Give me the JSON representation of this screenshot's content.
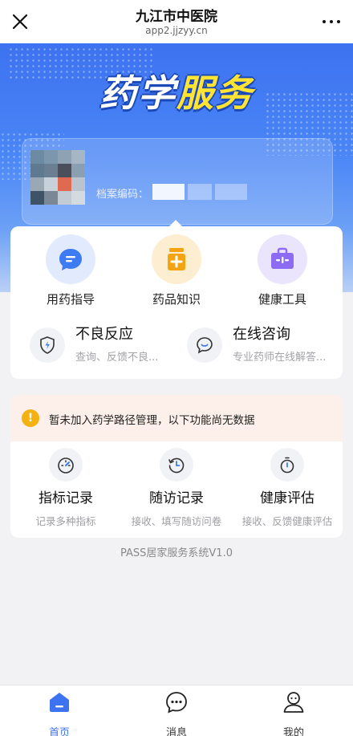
{
  "header": {
    "title": "九江市中医院",
    "url": "app2.jjzyy.cn"
  },
  "hero": {
    "title_white": "药学",
    "title_yellow": "服务"
  },
  "profile": {
    "record_label": "档案编码："
  },
  "services": [
    {
      "label": "用药指导",
      "icon": "chat-bubble-icon",
      "color": "#3d7bf3"
    },
    {
      "label": "药品知识",
      "icon": "medicine-bottle-icon",
      "color": "#f4a412"
    },
    {
      "label": "健康工具",
      "icon": "toolbox-icon",
      "color": "#8b6cf2"
    }
  ],
  "features": [
    {
      "title": "不良反应",
      "desc": "查询、反馈不良...",
      "icon": "shield-bolt-icon"
    },
    {
      "title": "在线咨询",
      "desc": "专业药师在线解答...",
      "icon": "chat-smile-icon"
    }
  ],
  "notice": "暂未加入药学路径管理，以下功能尚无数据",
  "path_items": [
    {
      "title": "指标记录",
      "desc": "记录多种指标",
      "icon": "gauge-icon"
    },
    {
      "title": "随访记录",
      "desc": "接收、填写随访问卷",
      "icon": "history-clock-icon"
    },
    {
      "title": "健康评估",
      "desc": "接收、反馈健康评估",
      "icon": "stopwatch-icon"
    }
  ],
  "version": "PASS居家服务系统V1.0",
  "tabs": [
    {
      "label": "首页",
      "icon": "home-icon",
      "active": true
    },
    {
      "label": "消息",
      "icon": "message-icon",
      "active": false
    },
    {
      "label": "我的",
      "icon": "user-icon",
      "active": false
    }
  ],
  "colors": {
    "primary": "#3d72f0",
    "warning": "#f3b212",
    "notice_bg": "#fdf0ea"
  }
}
